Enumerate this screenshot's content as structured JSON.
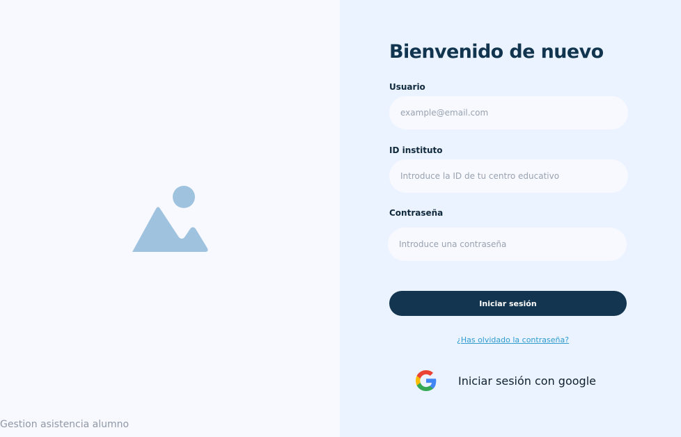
{
  "colors": {
    "background_left": "#f8f9ff",
    "background_right": "#eaf3ff",
    "title": "#12354f",
    "label": "#11293c",
    "button_primary": "#13354f",
    "link": "#2f9bd1",
    "placeholder_icon": "#9fc3df"
  },
  "hero": {
    "icon_name": "image-placeholder-icon"
  },
  "footer": {
    "caption": "Gestion asistencia alumno"
  },
  "login": {
    "title": "Bienvenido de nuevo",
    "fields": {
      "user": {
        "label": "Usuario",
        "value": "",
        "placeholder": "example@email.com"
      },
      "institute": {
        "label": "ID instituto",
        "value": "",
        "placeholder": "Introduce la ID de tu centro educativo"
      },
      "password": {
        "label": "Contraseña",
        "value": "",
        "placeholder": "Introduce una contraseña"
      }
    },
    "submit_label": "Iniciar sesión",
    "forgot_password_label": "¿Has olvidado la contraseña?",
    "google_label": "Iniciar sesión con google",
    "google_icon_name": "google-icon"
  }
}
